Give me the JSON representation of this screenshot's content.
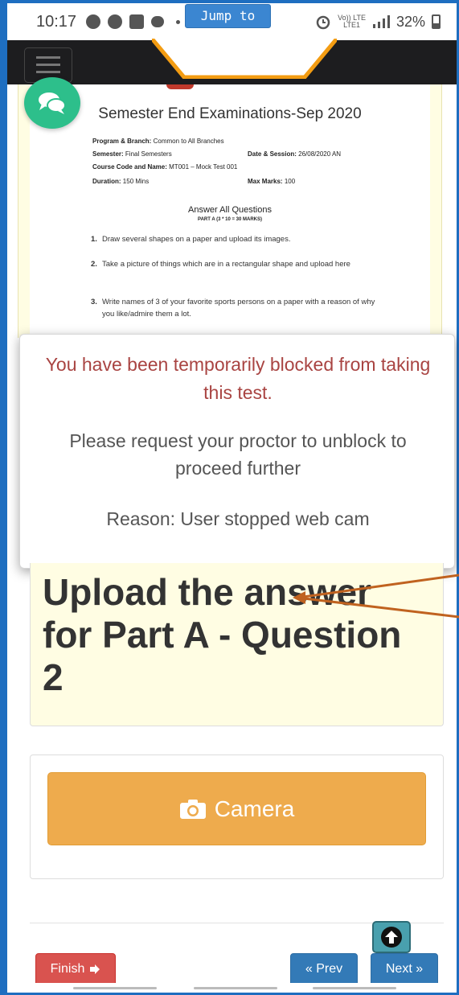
{
  "status_bar": {
    "time": "10:17",
    "network": "Vo)) LTE",
    "network_sub": "LTE1",
    "battery": "32%"
  },
  "app_header": {
    "jump_label": "Jump to"
  },
  "paper": {
    "title": "Semester End Examinations-Sep 2020",
    "program_label": "Program & Branch:",
    "program_value": "Common to All Branches",
    "semester_label": "Semester:",
    "semester_value": "Final Semesters",
    "date_label": "Date & Session:",
    "date_value": "26/08/2020 AN",
    "course_label": "Course Code and Name:",
    "course_value": "MT001 – Mock Test 001",
    "duration_label": "Duration:",
    "duration_value": "150 Mins",
    "marks_label": "Max Marks:",
    "marks_value": "100",
    "section_heading": "Answer All Questions",
    "part_heading": "PART A (3 * 10 = 30 MARKS)",
    "questions": [
      {
        "num": "1.",
        "text": "Draw several shapes on a paper and upload its images."
      },
      {
        "num": "2.",
        "text": "Take a picture of things which are in a rectangular shape and upload here"
      },
      {
        "num": "3.",
        "text": "Write names of 3 of your favorite sports persons on a paper with a reason of why you like/admire them a lot."
      }
    ]
  },
  "modal": {
    "warning": "You have been temporarily blocked from taking this test.",
    "request": "Please request your proctor to unblock to proceed further",
    "reason": "Reason: User stopped web cam"
  },
  "question_panel": {
    "text": "Upload the answer for Part A - Question 2"
  },
  "upload": {
    "camera_label": "Camera"
  },
  "footer": {
    "finish_label": "Finish",
    "prev_label": "« Prev",
    "next_label": "Next »"
  },
  "colors": {
    "warning_text": "#a94442",
    "camera_button": "#eeab4d",
    "finish_button": "#d9534f",
    "nav_button": "#337ab7",
    "chat_fab": "#2dbf8b",
    "annotation_arrow": "#c0621f"
  },
  "icons": {
    "chat": "chat-bubbles-icon",
    "camera": "camera-icon",
    "finish": "sign-out-icon",
    "scroll_top": "arrow-up-circle-icon"
  }
}
